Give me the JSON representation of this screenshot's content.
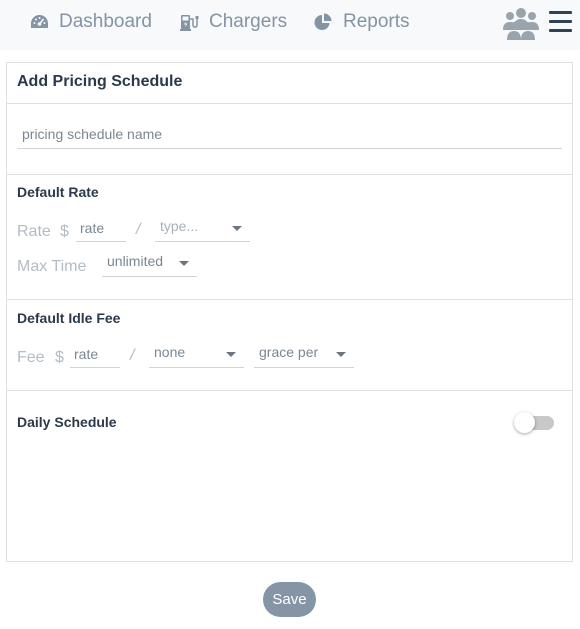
{
  "nav": {
    "dashboard_label": "Dashboard",
    "chargers_label": "Chargers",
    "reports_label": "Reports"
  },
  "colors": {
    "nav_text": "#8494a4",
    "save_button": "#8595a5",
    "heading": "#2b3a4a"
  },
  "icons": [
    "dashboard-icon",
    "chargers-icon",
    "reports-icon",
    "users-icon",
    "menu-icon"
  ],
  "form": {
    "title": "Add Pricing Schedule",
    "name_placeholder": "pricing schedule name",
    "default_rate": {
      "title": "Default Rate",
      "rate_label": "Rate",
      "currency": "$",
      "rate_placeholder": "rate",
      "separator": "/",
      "type_select": "type...",
      "max_time_label": "Max Time",
      "max_time_select": "unlimited"
    },
    "default_idle_fee": {
      "title": "Default Idle Fee",
      "fee_label": "Fee",
      "currency": "$",
      "rate_placeholder": "rate",
      "separator": "/",
      "unit_select": "none",
      "grace_select": "grace per"
    },
    "daily_schedule": {
      "title": "Daily Schedule",
      "enabled": false
    }
  },
  "save_label": "Save"
}
